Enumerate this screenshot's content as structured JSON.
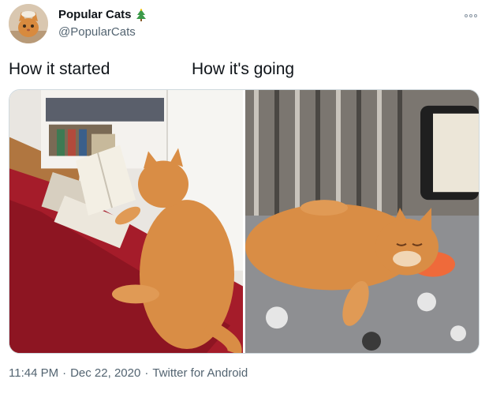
{
  "user": {
    "display_name": "Popular Cats",
    "handle": "@PopularCats",
    "badge_icon": "christmas-tree-icon"
  },
  "tweet": {
    "caption_left": "How it started",
    "caption_right": "How it's going"
  },
  "meta": {
    "time": "11:44 PM",
    "separator": "·",
    "date": "Dec 22, 2020",
    "client": "Twitter for Android"
  },
  "colors": {
    "text_primary": "#0f1419",
    "text_secondary": "#536471",
    "border": "#cfd9de"
  },
  "icons": {
    "more": "more-options-icon"
  }
}
